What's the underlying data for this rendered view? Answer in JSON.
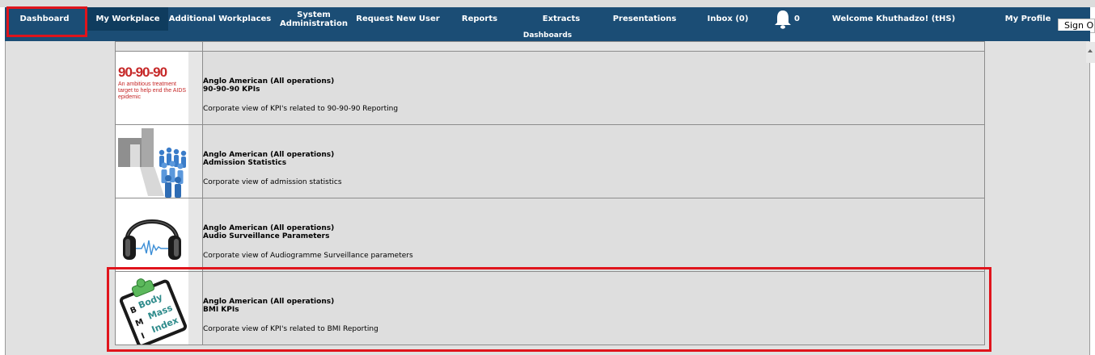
{
  "nav": {
    "items": [
      {
        "label": "Dashboard"
      },
      {
        "label": "My Workplace"
      },
      {
        "label": "Additional Workplaces"
      },
      {
        "label": "System Administration"
      },
      {
        "label": "Request New User"
      },
      {
        "label": "Reports"
      },
      {
        "label": "Extracts"
      },
      {
        "label": "Presentations"
      },
      {
        "label": "Inbox (0)"
      },
      {
        "label": "Welcome Khuthadzo! (tHS)"
      },
      {
        "label": "My Profile"
      }
    ],
    "notification_icon": "bell-icon",
    "notification_count": "0",
    "signout_label": "Sign Out"
  },
  "subheader": {
    "title": "Dashboards"
  },
  "dashboards": [
    {
      "organisation": "Anglo American (All operations)",
      "name": "90-90-90 KPIs",
      "description": "Corporate view of KPI's related to 90-90-90 Reporting",
      "thumb_title": "90-90-90",
      "thumb_subtitle": "An ambitious treatment target to help end the AIDS epidemic"
    },
    {
      "organisation": "Anglo American (All operations)",
      "name": "Admission Statistics",
      "description": "Corporate view of admission statistics",
      "thumb_icon": "building-crowd-icon"
    },
    {
      "organisation": "Anglo American (All operations)",
      "name": "Audio Surveillance Parameters",
      "description": "Corporate view of Audiogramme Surveillance parameters",
      "thumb_icon": "headphones-icon"
    },
    {
      "organisation": "Anglo American (All operations)",
      "name": "BMI KPIs",
      "description": "Corporate view of KPI's related to BMI Reporting",
      "thumb_icon": "bmi-clipboard-icon",
      "thumb_words": [
        "Body",
        "Mass",
        "Index"
      ],
      "thumb_letters": [
        "B",
        "M",
        "I"
      ]
    }
  ],
  "colors": {
    "nav_bg": "#1b4d75",
    "nav_active": "#0f3c5e",
    "content_bg": "#e1e1e1",
    "highlight": "#e0141c"
  }
}
